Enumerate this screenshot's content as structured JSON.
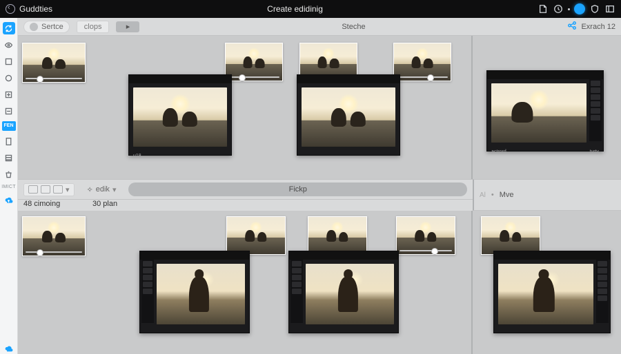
{
  "topbar": {
    "brand": "Guddties",
    "title": "Create edidinig"
  },
  "subbar": {
    "sertce": "Sertce",
    "clops": "clops",
    "steche": "Steche",
    "exrach": "Exrach 12"
  },
  "rail": {
    "pill": "FEN",
    "group_label": "IMICT"
  },
  "midbar": {
    "edik": "edik",
    "fickp": "Fickp",
    "count_left": "48 cimoing",
    "count_center": "30 plan",
    "right_a": "Al",
    "right_b": "Mve"
  },
  "cards": {
    "top_dark_left": {
      "hdr": "",
      "ftr_l": "u18",
      "ftr_r": ""
    },
    "top_dark_mid": {
      "hdr": "",
      "ftr_l": "",
      "ftr_r": ""
    },
    "top_dark_right": {
      "hdr": "",
      "ftr_l": "actrord",
      "ftr_r": "tvrty"
    }
  }
}
